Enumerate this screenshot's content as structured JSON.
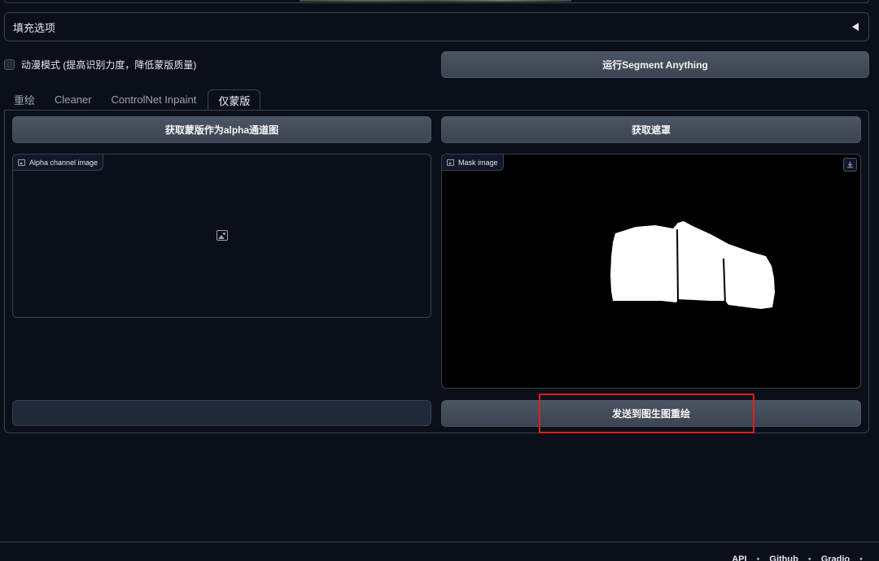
{
  "accordion": {
    "title": "填充选项"
  },
  "controls": {
    "checkbox_label": "动漫模式 (提高识别力度，降低蒙版质量)",
    "run_button": "运行Segment Anything"
  },
  "tabs": [
    {
      "label": "重绘",
      "active": false
    },
    {
      "label": "Cleaner",
      "active": false
    },
    {
      "label": "ControlNet Inpaint",
      "active": false
    },
    {
      "label": "仅蒙版",
      "active": true
    }
  ],
  "panel": {
    "alpha_button": "获取蒙版作为alpha通道图",
    "mask_button": "获取遮罩",
    "alpha_label": "Alpha channel image",
    "mask_label": "Mask image",
    "send_button": "发送到图生图重绘"
  },
  "footer": {
    "links": [
      "API",
      "Github",
      "Gradio"
    ],
    "separator": "•"
  },
  "colors": {
    "background": "#0b0f19",
    "button": "#4b5563",
    "highlight": "#e11d1d",
    "border": "#374151"
  }
}
